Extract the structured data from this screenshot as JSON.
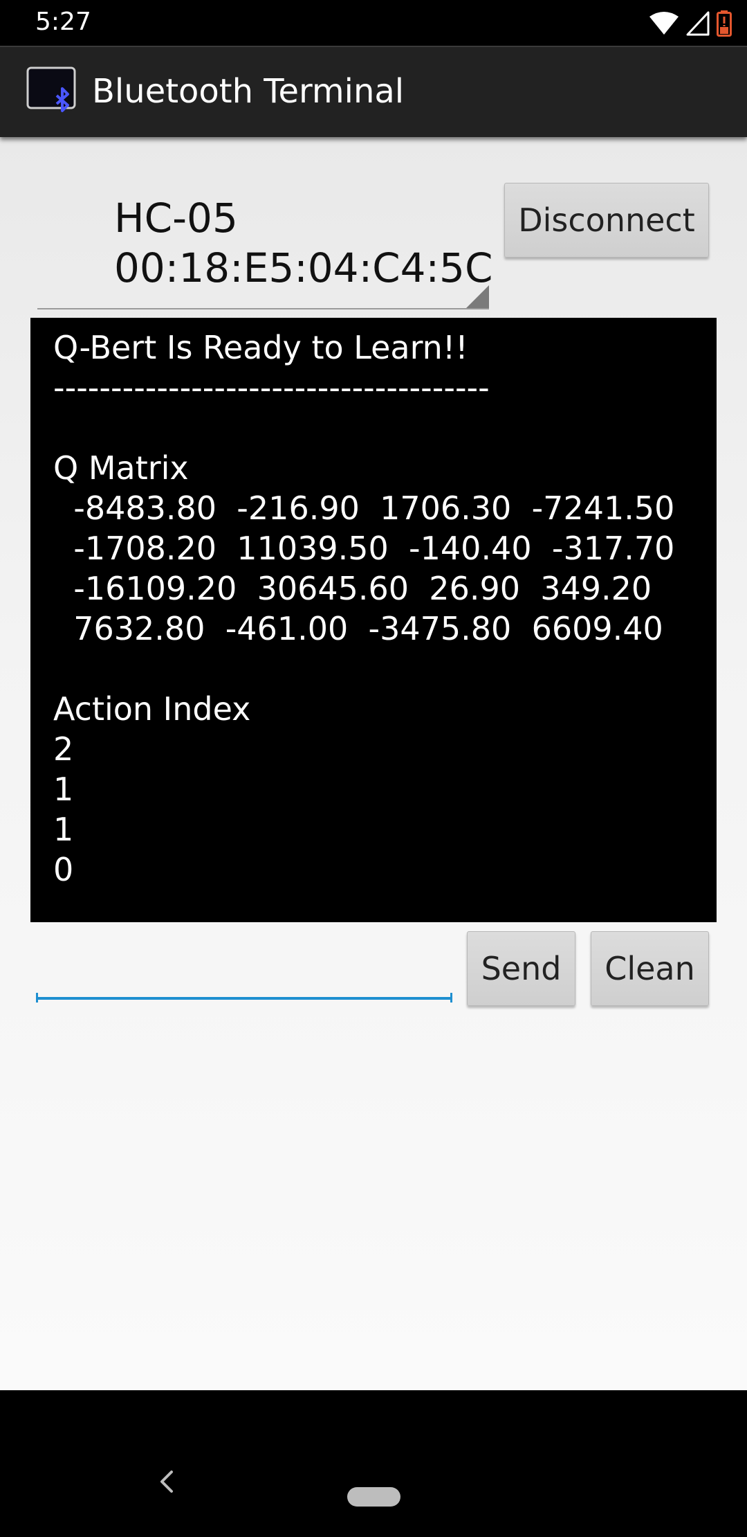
{
  "status_bar": {
    "time": "5:27",
    "icons": [
      "wifi-icon",
      "cell-signal-icon",
      "battery-low-icon"
    ],
    "battery_color": "#e4572e"
  },
  "app_bar": {
    "title": "Bluetooth Terminal",
    "logo_text": "Bluetooth Terminal",
    "background": "#222222"
  },
  "device_selector": {
    "name": "HC-05",
    "mac": "00:18:E5:04:C4:5C"
  },
  "buttons": {
    "disconnect": "Disconnect",
    "send": "Send",
    "clean": "Clean"
  },
  "terminal": {
    "lines": [
      "Q-Bert Is Ready to Learn!!",
      "--------------------------------------",
      "",
      "Q Matrix",
      "  -8483.80  -216.90  1706.30  -7241.50",
      "  -1708.20  11039.50  -140.40  -317.70",
      "  -16109.20  30645.60  26.90  349.20",
      "  7632.80  -461.00  -3475.80  6609.40",
      "",
      "Action Index",
      "2",
      "1",
      "1",
      "0"
    ]
  },
  "message_input": {
    "value": "",
    "placeholder": "",
    "accent": "#1e8fd0"
  },
  "nav_bar": {
    "icons": [
      "back-icon",
      "home-pill-icon"
    ]
  }
}
